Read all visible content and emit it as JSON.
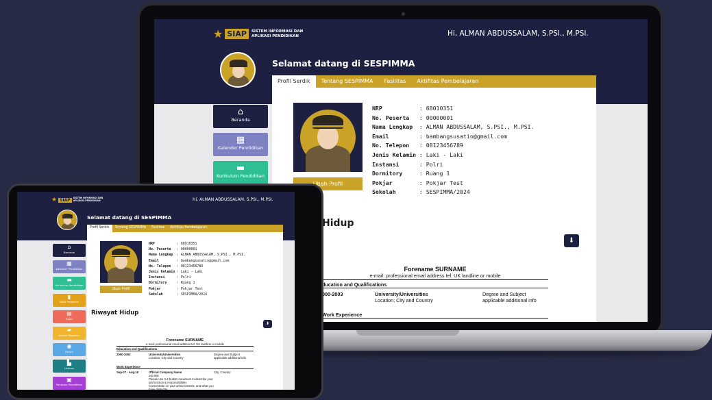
{
  "brand": {
    "name": "SIAP",
    "line1": "SISTEM INFORMASI DAN",
    "line2": "APLIKASI PENDIDIKAN"
  },
  "header": {
    "greeting": "Hi, ALMAN ABDUSSALAM, S.PSI., M.PSI."
  },
  "welcome": "Selamat datang di SESPIMMA",
  "tabs": [
    "Profil Serdik",
    "Tentang SESPIMMA",
    "Fasilitas",
    "Aktifitas Pembelajaran"
  ],
  "profile": {
    "button": "Ubah Profil",
    "fields": [
      {
        "key": "NRP",
        "value": "68010351"
      },
      {
        "key": "No. Peserta",
        "value": "00000001"
      },
      {
        "key": "Nama Lengkap",
        "value": "ALMAN ABDUSSALAM, S.PSI., M.PSI."
      },
      {
        "key": "Email",
        "value": "bambangsusatio@gmail.com"
      },
      {
        "key": "No. Telepon",
        "value": "08123456789"
      },
      {
        "key": "Jenis Kelamin",
        "value": "Laki - Laki"
      },
      {
        "key": "Instansi",
        "value": "Polri"
      },
      {
        "key": "Dormitory",
        "value": "Ruang 1"
      },
      {
        "key": "Pokjar",
        "value": "Pokjar Test"
      },
      {
        "key": "Sekolah",
        "value": "SESPIMMA/2024"
      }
    ]
  },
  "menu": [
    {
      "label": "Beranda",
      "color": "#1e2041",
      "icon": "home-icon"
    },
    {
      "label": "Kalender Pendidikan",
      "color": "#7f82c2",
      "icon": "calendar-icon"
    },
    {
      "label": "Kurikulum Pendidikan",
      "color": "#2fbf94",
      "icon": "book-icon"
    },
    {
      "label": "Mata Pelajaran",
      "color": "#e4a21a",
      "icon": "books-icon"
    },
    {
      "label": "Tugas",
      "color": "#ef6a5a",
      "icon": "task-icon"
    },
    {
      "label": "Jadwal Kegiatan",
      "color": "#f0b52d",
      "icon": "schedule-icon"
    },
    {
      "label": "Forum",
      "color": "#5aa7e6",
      "icon": "forum-icon"
    },
    {
      "label": "Literasi",
      "color": "#1f7f86",
      "icon": "literasi-icon"
    },
    {
      "label": "Panduan Pendidikan",
      "color": "#a53fd6",
      "icon": "guide-icon"
    }
  ],
  "section": {
    "title": "Riwayat Hidup",
    "big_title_fragment": "Hidup"
  },
  "cv": {
    "name": "Forename SURNAME",
    "contact": "e-mail: professional email address tel: UK landline or mobile",
    "edu_heading": "Education and Qualifications",
    "edu_heading_cut": "ducation and Qualifications",
    "edu_years": "2000-2003",
    "edu_years_cut": "000-2003",
    "edu_inst": "University/Universities",
    "edu_loc": "Location; City and Country",
    "edu_degree": "Degree and Subject",
    "edu_info": "applicable additional info",
    "work_heading": "Work Experience",
    "work_dates": "Sep-07 - Aug-10",
    "work_company": "Official Company Name",
    "work_place": "City, Country",
    "work_title": "Job title",
    "bullet1": "Please use 3-4 bullets maximum to describe your job function & responsibilities",
    "bullet2": "Concentrate on your achievements, and what you have distinctly"
  }
}
